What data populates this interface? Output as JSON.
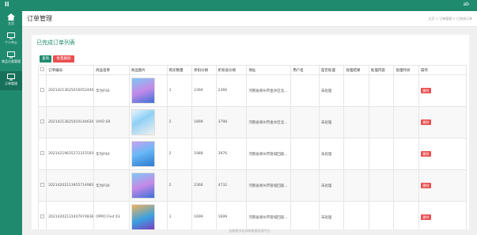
{
  "app": {
    "logo": "li",
    "user": "ab"
  },
  "sidebar": {
    "items": [
      {
        "label": "主页",
        "icon": "home-icon"
      },
      {
        "label": "个人中心",
        "icon": "monitor-icon"
      },
      {
        "label": "商品分类管理",
        "icon": "monitor-icon"
      },
      {
        "label": "订单管理",
        "icon": "monitor-icon"
      }
    ]
  },
  "header": {
    "title": "订单管理",
    "breadcrumb": "主页 > 订单管理 > 已完成订单"
  },
  "panel": {
    "title": "已完成订单列表",
    "query_label": "查询",
    "batch_delete_label": "批量删除"
  },
  "table": {
    "columns": [
      "订单编号",
      "商品名称",
      "商品图片",
      "购买数量",
      "折扣价格",
      "折扣总价格",
      "地址",
      "用户名",
      "是否处理",
      "处理结果",
      "处理内容",
      "处理时间",
      "操作"
    ],
    "rows": [
      {
        "order_id": "20214213625016052440",
        "name": "华为P30",
        "qty": "1",
        "price": "2366",
        "total": "2366",
        "addr": "河南省郑州市金水区北...",
        "user": "",
        "processed": "未处理",
        "thumb_class": "thumb t1"
      },
      {
        "order_id": "20214213625010144620",
        "name": "VIVO S9",
        "qty": "2",
        "price": "1899",
        "total": "3798",
        "addr": "河南省郑州市金水区北...",
        "user": "",
        "processed": "未处理",
        "thumb_class": "thumb t2"
      },
      {
        "order_id": "20214219635272315593",
        "name": "华为P40",
        "qty": "2",
        "price": "1988",
        "total": "3976",
        "addr": "河南省郑州市管城回族...",
        "user": "",
        "processed": "未处理",
        "thumb_class": "thumb t3"
      },
      {
        "order_id": "20214202113955714983",
        "name": "华为P30",
        "qty": "2",
        "price": "2366",
        "total": "4732",
        "addr": "河南省郑州市管城回族...",
        "user": "",
        "processed": "未处理",
        "thumb_class": "thumb t1"
      },
      {
        "order_id": "20214202131447974836",
        "name": "OPPO Find X3",
        "qty": "1",
        "price": "1699",
        "total": "1699",
        "addr": "河南省郑州市管城回族...",
        "user": "",
        "processed": "未处理",
        "thumb_class": "thumb t4"
      }
    ],
    "delete_label": "删除"
  },
  "footer": {
    "text": "宏能数字化训练数据资源平台"
  },
  "colors": {
    "primary": "#1f8a6e",
    "danger": "#e94e4e"
  }
}
